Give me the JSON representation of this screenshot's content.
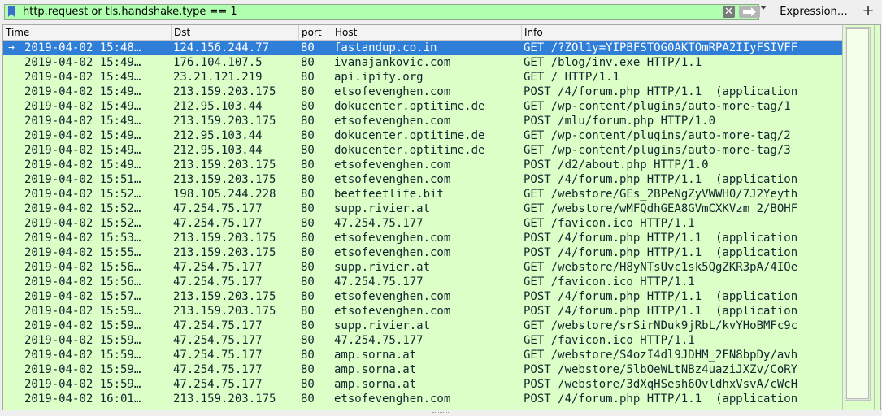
{
  "filter": {
    "value": "http.request or tls.handshake.type == 1",
    "clear_glyph": "✕",
    "expression_label": "Expression…",
    "add_label": "+"
  },
  "columns": [
    "Time",
    "Dst",
    "port",
    "Host",
    "Info"
  ],
  "colors": {
    "row_bg": "#dcffc8",
    "selected_bg": "#2f7ed8",
    "filter_bg": "#afffaf"
  },
  "rows": [
    {
      "time": "2019-04-02 15:48…",
      "dst": "124.156.244.77",
      "port": "80",
      "host": "fastandup.co.in",
      "info": "GET /?ZOl1y=YIPBFSTOG0AKTOmRPA2IIyFSIVFF"
    },
    {
      "time": "2019-04-02 15:49…",
      "dst": "176.104.107.5",
      "port": "80",
      "host": "ivanajankovic.com",
      "info": "GET /blog/inv.exe HTTP/1.1"
    },
    {
      "time": "2019-04-02 15:49…",
      "dst": "23.21.121.219",
      "port": "80",
      "host": "api.ipify.org",
      "info": "GET / HTTP/1.1"
    },
    {
      "time": "2019-04-02 15:49…",
      "dst": "213.159.203.175",
      "port": "80",
      "host": "etsofevenghen.com",
      "info": "POST /4/forum.php HTTP/1.1  (application"
    },
    {
      "time": "2019-04-02 15:49…",
      "dst": "212.95.103.44",
      "port": "80",
      "host": "dokucenter.optitime.de",
      "info": "GET /wp-content/plugins/auto-more-tag/1"
    },
    {
      "time": "2019-04-02 15:49…",
      "dst": "213.159.203.175",
      "port": "80",
      "host": "etsofevenghen.com",
      "info": "POST /mlu/forum.php HTTP/1.0"
    },
    {
      "time": "2019-04-02 15:49…",
      "dst": "212.95.103.44",
      "port": "80",
      "host": "dokucenter.optitime.de",
      "info": "GET /wp-content/plugins/auto-more-tag/2"
    },
    {
      "time": "2019-04-02 15:49…",
      "dst": "212.95.103.44",
      "port": "80",
      "host": "dokucenter.optitime.de",
      "info": "GET /wp-content/plugins/auto-more-tag/3"
    },
    {
      "time": "2019-04-02 15:49…",
      "dst": "213.159.203.175",
      "port": "80",
      "host": "etsofevenghen.com",
      "info": "POST /d2/about.php HTTP/1.0"
    },
    {
      "time": "2019-04-02 15:51…",
      "dst": "213.159.203.175",
      "port": "80",
      "host": "etsofevenghen.com",
      "info": "POST /4/forum.php HTTP/1.1  (application"
    },
    {
      "time": "2019-04-02 15:52…",
      "dst": "198.105.244.228",
      "port": "80",
      "host": "beetfeetlife.bit",
      "info": "GET /webstore/GEs_2BPeNgZyVWWH0/7J2Yeyth"
    },
    {
      "time": "2019-04-02 15:52…",
      "dst": "47.254.75.177",
      "port": "80",
      "host": "supp.rivier.at",
      "info": "GET /webstore/wMFQdhGEA8GVmCXKVzm_2/BOHF"
    },
    {
      "time": "2019-04-02 15:52…",
      "dst": "47.254.75.177",
      "port": "80",
      "host": "47.254.75.177",
      "info": "GET /favicon.ico HTTP/1.1"
    },
    {
      "time": "2019-04-02 15:53…",
      "dst": "213.159.203.175",
      "port": "80",
      "host": "etsofevenghen.com",
      "info": "POST /4/forum.php HTTP/1.1  (application"
    },
    {
      "time": "2019-04-02 15:55…",
      "dst": "213.159.203.175",
      "port": "80",
      "host": "etsofevenghen.com",
      "info": "POST /4/forum.php HTTP/1.1  (application"
    },
    {
      "time": "2019-04-02 15:56…",
      "dst": "47.254.75.177",
      "port": "80",
      "host": "supp.rivier.at",
      "info": "GET /webstore/H8yNTsUvc1sk5QgZKR3pA/4IQe"
    },
    {
      "time": "2019-04-02 15:56…",
      "dst": "47.254.75.177",
      "port": "80",
      "host": "47.254.75.177",
      "info": "GET /favicon.ico HTTP/1.1"
    },
    {
      "time": "2019-04-02 15:57…",
      "dst": "213.159.203.175",
      "port": "80",
      "host": "etsofevenghen.com",
      "info": "POST /4/forum.php HTTP/1.1  (application"
    },
    {
      "time": "2019-04-02 15:59…",
      "dst": "213.159.203.175",
      "port": "80",
      "host": "etsofevenghen.com",
      "info": "POST /4/forum.php HTTP/1.1  (application"
    },
    {
      "time": "2019-04-02 15:59…",
      "dst": "47.254.75.177",
      "port": "80",
      "host": "supp.rivier.at",
      "info": "GET /webstore/srSirNDuk9jRbL/kvYHoBMFc9c"
    },
    {
      "time": "2019-04-02 15:59…",
      "dst": "47.254.75.177",
      "port": "80",
      "host": "47.254.75.177",
      "info": "GET /favicon.ico HTTP/1.1"
    },
    {
      "time": "2019-04-02 15:59…",
      "dst": "47.254.75.177",
      "port": "80",
      "host": "amp.sorna.at",
      "info": "GET /webstore/S4ozI4dl9JDHM_2FN8bpDy/avh"
    },
    {
      "time": "2019-04-02 15:59…",
      "dst": "47.254.75.177",
      "port": "80",
      "host": "amp.sorna.at",
      "info": "POST /webstore/5lbOeWLtNBz4uaziJXZv/CoRY"
    },
    {
      "time": "2019-04-02 15:59…",
      "dst": "47.254.75.177",
      "port": "80",
      "host": "amp.sorna.at",
      "info": "POST /webstore/3dXqHSesh6OvldhxVsvA/cWcH"
    },
    {
      "time": "2019-04-02 16:01…",
      "dst": "213.159.203.175",
      "port": "80",
      "host": "etsofevenghen.com",
      "info": "POST /4/forum.php HTTP/1.1  (application"
    }
  ]
}
